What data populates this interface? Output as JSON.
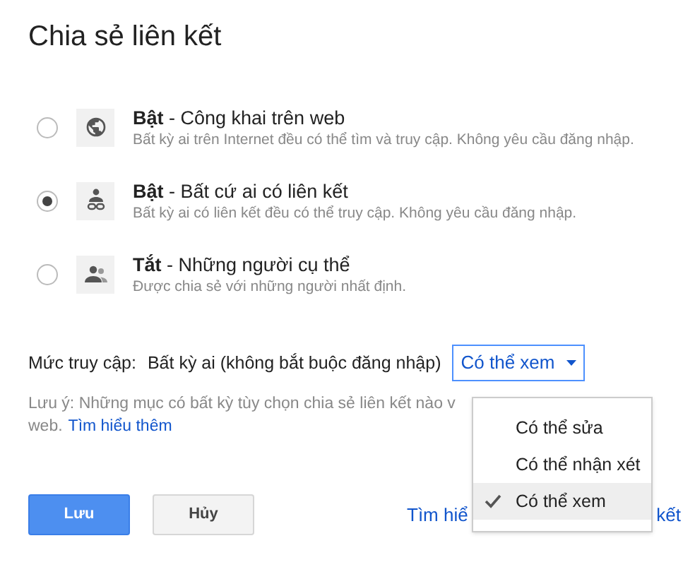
{
  "title": "Chia sẻ liên kết",
  "options": [
    {
      "kind": "globe",
      "state": "Bật",
      "label": " - Công khai trên web",
      "description": "Bất kỳ ai trên Internet đều có thể tìm và truy cập. Không yêu cầu đăng nhập.",
      "selected": false
    },
    {
      "kind": "link",
      "state": "Bật",
      "label": " - Bất cứ ai có liên kết",
      "description": "Bất kỳ ai có liên kết đều có thể truy cập. Không yêu cầu đăng nhập.",
      "selected": true
    },
    {
      "kind": "people",
      "state": "Tắt",
      "label": " - Những người cụ thể",
      "description": "Được chia sẻ với những người nhất định.",
      "selected": false
    }
  ],
  "access": {
    "label": "Mức truy cập:",
    "value": "Bất kỳ ai (không bắt buộc đăng nhập)",
    "dropdown": "Có thể xem"
  },
  "note": {
    "text": "Lưu ý: Những mục có bất kỳ tùy chọn chia sẻ liên kết nào v",
    "text_2": "web.",
    "link": "Tìm hiểu thêm"
  },
  "buttons": [
    {
      "kind": "primary",
      "label": "Lưu"
    },
    {
      "kind": "secondary",
      "label": "Hủy"
    }
  ],
  "footer_link": {
    "left": "Tìm hiể",
    "right": "kết"
  },
  "menu": [
    {
      "label": "Có thể sửa",
      "selected": false
    },
    {
      "label": "Có thể nhận xét",
      "selected": false
    },
    {
      "label": "Có thể xem",
      "selected": true
    }
  ]
}
